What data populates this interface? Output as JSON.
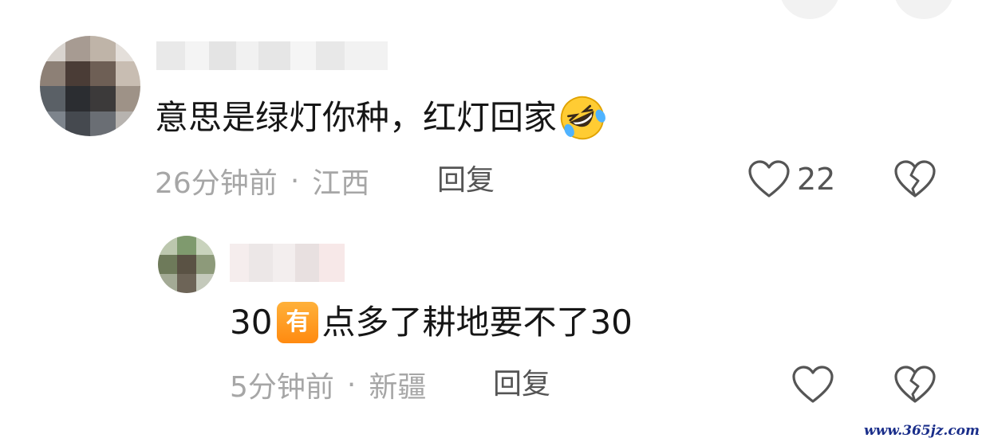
{
  "colors": {
    "text_primary": "#161616",
    "text_meta": "#a6a6a6",
    "text_action": "#555555",
    "tag_orange": "#ff9a22",
    "watermark": "#1a2e8a"
  },
  "comments": [
    {
      "username": "",
      "text": "意思是绿灯你种，红灯回家",
      "emoji": "rolling-on-floor-laughing",
      "time": "26分钟前",
      "separator": "·",
      "location": "江西",
      "reply_label": "回复",
      "like_count": "22",
      "like_icon": "heart-outline-icon",
      "dislike_icon": "broken-heart-icon"
    },
    {
      "username": "",
      "text_prefix": "30",
      "tag": "有",
      "text_suffix": "点多了耕地要不了30",
      "time": "5分钟前",
      "separator": "·",
      "location": "新疆",
      "reply_label": "回复",
      "like_icon": "heart-outline-icon",
      "dislike_icon": "broken-heart-icon"
    }
  ],
  "watermark": "www.365jz.com"
}
